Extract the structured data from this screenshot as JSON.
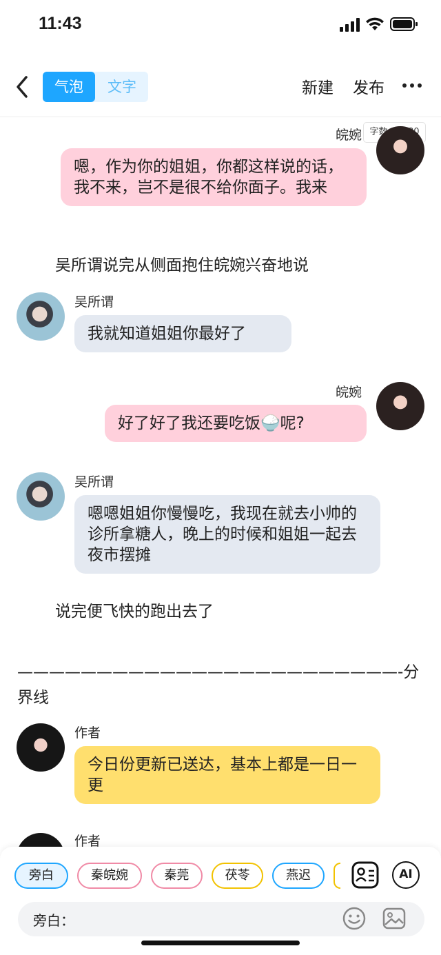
{
  "status": {
    "time": "11:43"
  },
  "nav": {
    "mode_bubble": "气泡",
    "mode_text": "文字",
    "new_label": "新建",
    "publish_label": "发布"
  },
  "chat": {
    "word_count": "字数：1380",
    "messages": [
      {
        "sender": "皖婉",
        "text": "嗯，作为你的姐姐，你都这样说的话，我不来，岂不是很不给你面子。我来"
      },
      {
        "narration": "吴所谓说完从侧面抱住皖婉兴奋地说"
      },
      {
        "sender": "吴所谓",
        "text": "我就知道姐姐你最好了"
      },
      {
        "sender": "皖婉",
        "text": "好了好了我还要吃饭🍚呢?"
      },
      {
        "sender": "吴所谓",
        "text": "嗯嗯姐姐你慢慢吃，我现在就去小帅的诊所拿糖人，晚上的时候和姐姐一起去夜市摆摊"
      },
      {
        "narration": "说完便飞快的跑出去了"
      },
      {
        "divider": "————————————————————————-分界线"
      },
      {
        "sender": "作者",
        "text": "今日份更新已送达，基本上都是一日一更"
      },
      {
        "sender": "作者",
        "text": ""
      }
    ]
  },
  "bottom": {
    "chips": [
      "旁白",
      "秦皖婉",
      "秦莞",
      "茯苓",
      "燕迟"
    ],
    "chip_colors": [
      "#1ea6ff",
      "#f08aa6",
      "#f08aa6",
      "#f2c200",
      "#1ea6ff"
    ],
    "ai_label": "AI",
    "input_label": "旁白："
  }
}
